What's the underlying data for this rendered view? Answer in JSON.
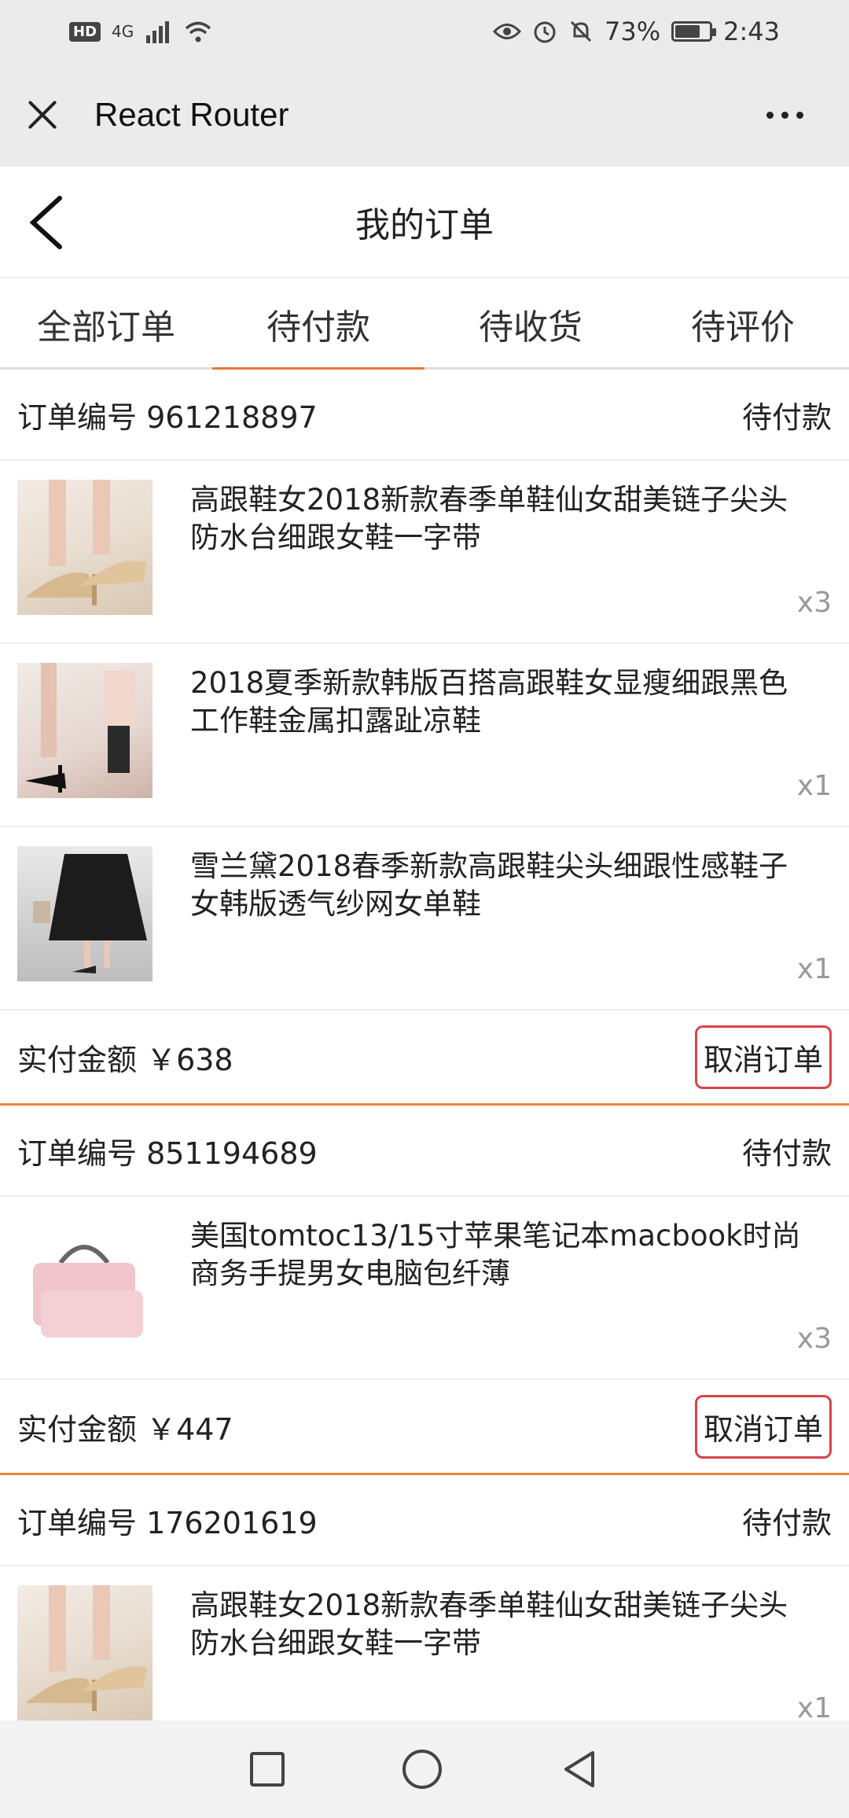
{
  "status_bar": {
    "hd": "HD",
    "network": "4G",
    "battery": "73%",
    "battery_level": 0.73,
    "time": "2:43"
  },
  "browser": {
    "title": "React Router"
  },
  "header": {
    "title": "我的订单"
  },
  "tabs": [
    {
      "label": "全部订单",
      "active": false
    },
    {
      "label": "待付款",
      "active": true
    },
    {
      "label": "待收货",
      "active": false
    },
    {
      "label": "待评价",
      "active": false
    }
  ],
  "orders": [
    {
      "number_label": "订单编号 961218897",
      "status": "待付款",
      "items": [
        {
          "name": "高跟鞋女2018新款春季单鞋仙女甜美链子尖头防水台细跟女鞋一字带",
          "qty": "x3",
          "image": "beige-heels-image"
        },
        {
          "name": "2018夏季新款韩版百搭高跟鞋女显瘦细跟黑色工作鞋金属扣露趾凉鞋",
          "qty": "x1",
          "image": "black-sandals-image"
        },
        {
          "name": "雪兰黛2018春季新款高跟鞋尖头细跟性感鞋子女韩版透气纱网女单鞋",
          "qty": "x1",
          "image": "mesh-heels-image"
        }
      ],
      "total_label": "实付金额 ￥638",
      "cancel_label": "取消订单"
    },
    {
      "number_label": "订单编号 851194689",
      "status": "待付款",
      "items": [
        {
          "name": "美国tomtoc13/15寸苹果笔记本macbook时尚商务手提男女电脑包纤薄",
          "qty": "x3",
          "image": "pink-laptop-bag-image"
        }
      ],
      "total_label": "实付金额 ￥447",
      "cancel_label": "取消订单"
    },
    {
      "number_label": "订单编号 176201619",
      "status": "待付款",
      "items": [
        {
          "name": "高跟鞋女2018新款春季单鞋仙女甜美链子尖头防水台细跟女鞋一字带",
          "qty": "x1",
          "image": "beige-heels-image"
        }
      ]
    }
  ],
  "colors": {
    "accent": "#e8773b",
    "cancel_border": "#d9434a",
    "bar_bg": "#ebebeb"
  }
}
